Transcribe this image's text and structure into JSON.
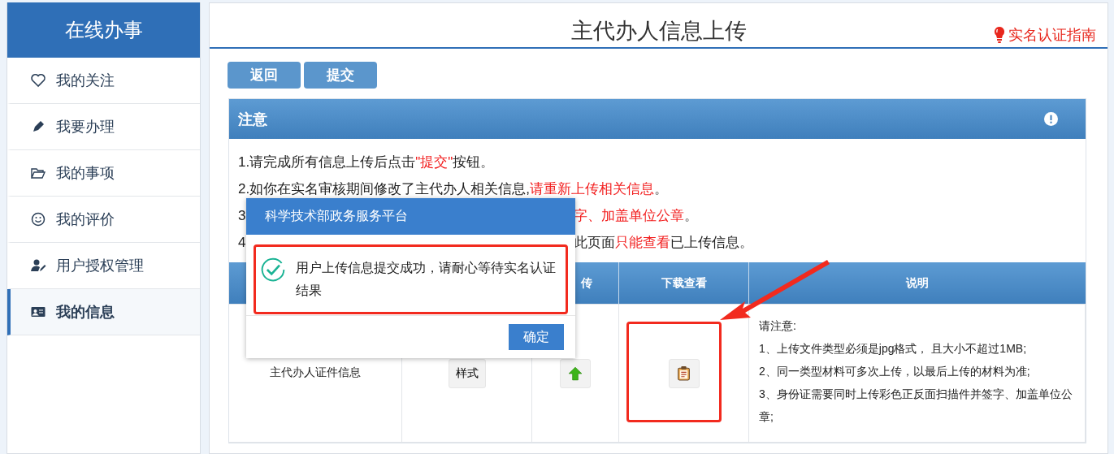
{
  "sidebar": {
    "title": "在线办事",
    "items": [
      {
        "label": "我的关注",
        "kind": "heart",
        "selected": false
      },
      {
        "label": "我要办理",
        "kind": "pen",
        "selected": false
      },
      {
        "label": "我的事项",
        "kind": "folder",
        "selected": false
      },
      {
        "label": "我的评价",
        "kind": "smile",
        "selected": false
      },
      {
        "label": "用户授权管理",
        "kind": "user",
        "selected": false
      },
      {
        "label": "我的信息",
        "kind": "card",
        "selected": true
      }
    ]
  },
  "page": {
    "title": "主代办人信息上传",
    "guide_link": "实名认证指南",
    "buttons": [
      "返回",
      "提交"
    ]
  },
  "notice": {
    "title": "注意",
    "lines": [
      {
        "parts": [
          {
            "text": "1.请完成所有信息上传后点击",
            "red": false
          },
          {
            "text": "\"提交\"",
            "red": true
          },
          {
            "text": "按钮。",
            "red": false
          }
        ]
      },
      {
        "parts": [
          {
            "text": "2.如你在实名审核期间修改了主代办人相关信息,",
            "red": false
          },
          {
            "text": "请重新上传相关信息",
            "red": true
          },
          {
            "text": "。",
            "red": false
          }
        ]
      },
      {
        "lead": "3",
        "parts": [
          {
            "text": "字、加盖单位公章",
            "red": true
          },
          {
            "text": "。",
            "red": false
          }
        ]
      },
      {
        "lead": "4",
        "parts": [
          {
            "text": "此页面",
            "red": false
          },
          {
            "text": "只能查看",
            "red": true
          },
          {
            "text": "已上传信息。",
            "red": false
          }
        ]
      }
    ]
  },
  "table": {
    "columns": [
      {},
      {},
      {
        "label": "传"
      },
      {
        "label": "下载查看"
      },
      {
        "label": "说明"
      }
    ],
    "rows": [
      {
        "name": "主代办人证件信息",
        "sample_button": "样式",
        "notes": [
          "请注意:",
          "1、上传文件类型必须是jpg格式， 且大小不超过1MB;",
          "2、同一类型材料可多次上传，以最后上传的材料为准;",
          "3、身份证需要同时上传彩色正反面扫描件并签字、加盖单位公章;"
        ]
      }
    ]
  },
  "dialog": {
    "title": "科学技术部政务服务平台",
    "message": "用户上传信息提交成功，请耐心等待实名认证结果",
    "button": "确定"
  }
}
